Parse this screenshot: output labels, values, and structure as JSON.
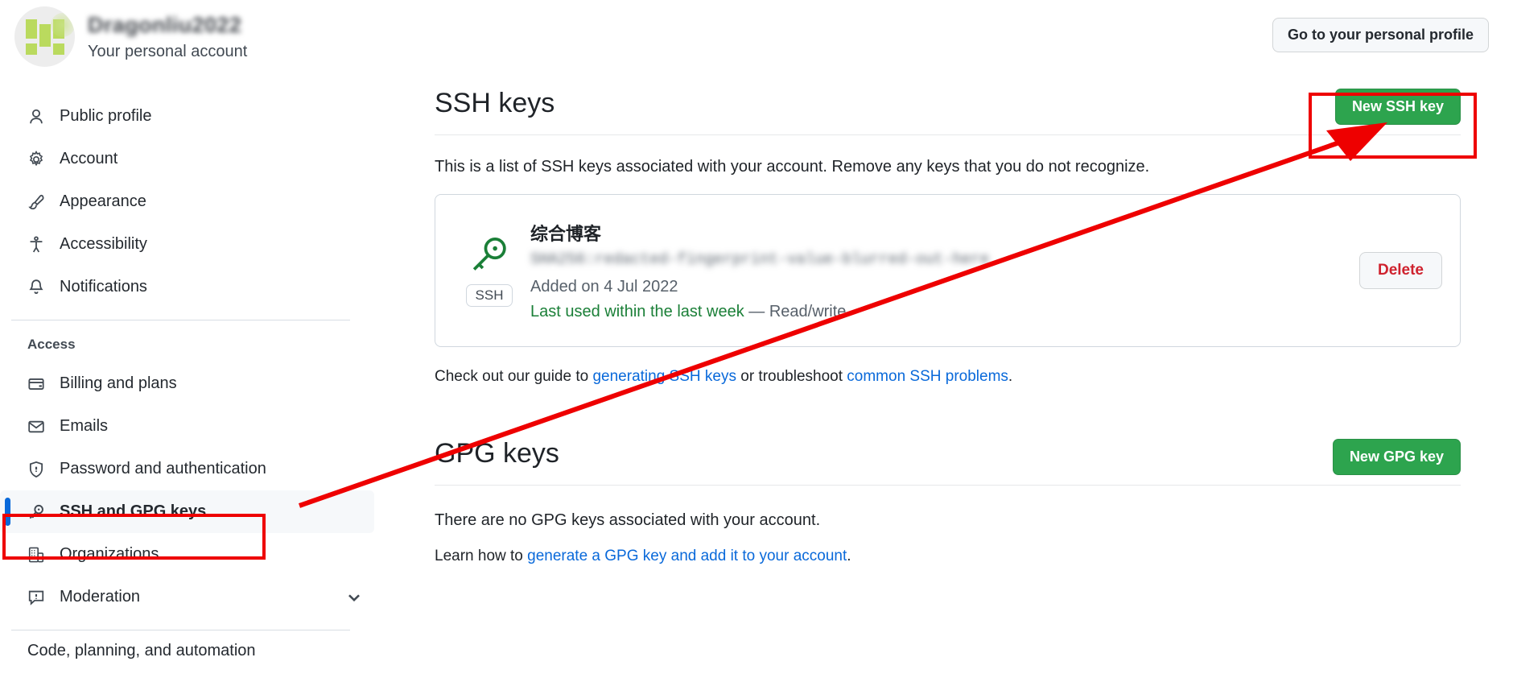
{
  "account": {
    "username": "Dragonliu2022",
    "subtitle": "Your personal account",
    "avatar_icon": "identicon-avatar",
    "profile_button": "Go to your personal profile"
  },
  "sidebar": {
    "primary_items": [
      {
        "label": "Public profile",
        "icon": "person-icon",
        "active": false
      },
      {
        "label": "Account",
        "icon": "gear-icon",
        "active": false
      },
      {
        "label": "Appearance",
        "icon": "paintbrush-icon",
        "active": false
      },
      {
        "label": "Accessibility",
        "icon": "accessibility-icon",
        "active": false
      },
      {
        "label": "Notifications",
        "icon": "bell-icon",
        "active": false
      }
    ],
    "section_label": "Access",
    "access_items": [
      {
        "label": "Billing and plans",
        "icon": "credit-card-icon",
        "active": false
      },
      {
        "label": "Emails",
        "icon": "mail-icon",
        "active": false
      },
      {
        "label": "Password and authentication",
        "icon": "shield-lock-icon",
        "active": false
      },
      {
        "label": "SSH and GPG keys",
        "icon": "key-icon",
        "active": true
      },
      {
        "label": "Organizations",
        "icon": "organization-icon",
        "active": false
      },
      {
        "label": "Moderation",
        "icon": "report-icon",
        "active": false,
        "chevron": "chevron-down-icon"
      }
    ],
    "cut_off_item": "Code, planning, and automation"
  },
  "ssh_section": {
    "title": "SSH keys",
    "new_key_button": "New SSH key",
    "description": "This is a list of SSH keys associated with your account. Remove any keys that you do not recognize.",
    "key": {
      "name": "综合博客",
      "fingerprint": "SHA256:redacted-fingerprint-value-blurred-out-here",
      "badge": "SSH",
      "key_icon": "key-icon",
      "added": "Added on 4 Jul 2022",
      "last_used": "Last used within the last week",
      "permission": "— Read/write",
      "delete_button": "Delete"
    },
    "guide_prefix": "Check out our guide to ",
    "guide_link1": "generating SSH keys",
    "guide_middle": " or troubleshoot ",
    "guide_link2": "common SSH problems",
    "guide_suffix": "."
  },
  "gpg_section": {
    "title": "GPG keys",
    "new_key_button": "New GPG key",
    "empty_message": "There are no GPG keys associated with your account.",
    "learn_prefix": "Learn how to ",
    "learn_link": "generate a GPG key and add it to your account",
    "learn_suffix": "."
  },
  "annotations": {
    "highlight_color": "#ee0000",
    "arrow_from": "SSH and GPG keys sidebar item",
    "arrow_to": "New SSH key button"
  },
  "colors": {
    "accent_green": "#2da44e",
    "link_blue": "#0969da",
    "danger_red": "#cf222e",
    "active_bar_blue": "#0969da",
    "annotation_red": "#ee0000"
  }
}
